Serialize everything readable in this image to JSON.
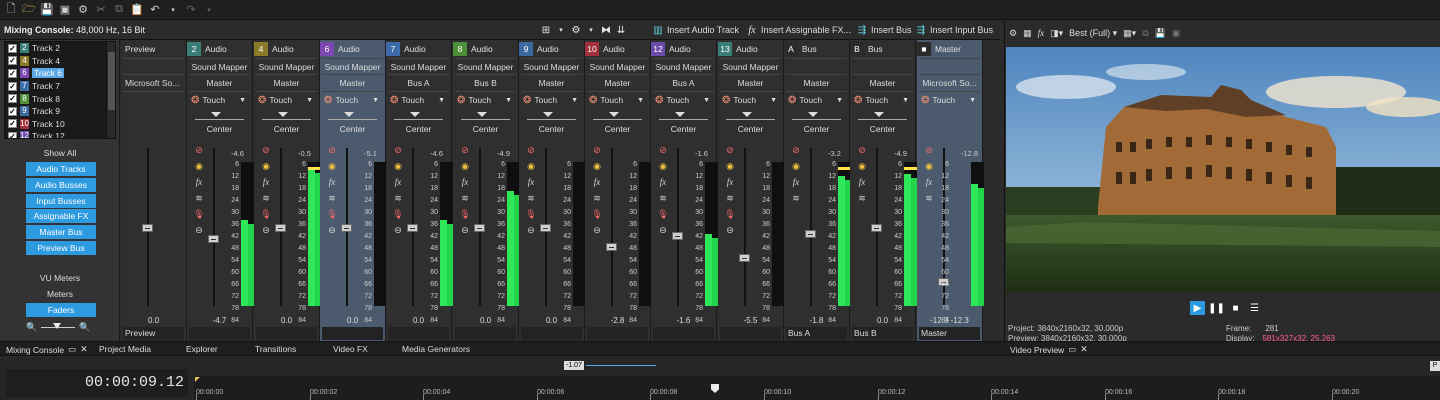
{
  "toolbar": {
    "icons": [
      "new-file-icon",
      "open-folder-icon",
      "save-icon",
      "save-as-icon",
      "properties-gear-icon",
      "cut-icon",
      "copy-icon",
      "paste-icon",
      "undo-icon",
      "undo-dropdown-icon",
      "redo-icon",
      "redo-dropdown-icon"
    ]
  },
  "mixer": {
    "title": "Mixing Console:",
    "subtitle": "48,000 Hz, 16 Bit",
    "actions": {
      "insert_audio_track": "Insert Audio Track",
      "insert_assignable_fx": "Insert Assignable FX...",
      "insert_bus": "Insert Bus",
      "insert_input_bus": "Insert Input Bus"
    },
    "track_list": [
      {
        "num": "2",
        "label": "Track 2",
        "color": "#3b7e78",
        "selected": false
      },
      {
        "num": "4",
        "label": "Track 4",
        "color": "#8a7a2a",
        "selected": false
      },
      {
        "num": "6",
        "label": "Track 6",
        "color": "#7a48b0",
        "selected": true
      },
      {
        "num": "7",
        "label": "Track 7",
        "color": "#3d6aa8",
        "selected": false
      },
      {
        "num": "8",
        "label": "Track 8",
        "color": "#4f8f3a",
        "selected": false
      },
      {
        "num": "9",
        "label": "Track 9",
        "color": "#3b6aa0",
        "selected": false
      },
      {
        "num": "10",
        "label": "Track 10",
        "color": "#a0303a",
        "selected": false
      },
      {
        "num": "12",
        "label": "Track 12",
        "color": "#6a4aa8",
        "selected": false
      }
    ],
    "show_all": "Show All",
    "view_buttons": [
      "Audio Tracks",
      "Audio Busses",
      "Input Busses",
      "Assignable FX",
      "Master Bus",
      "Preview Bus"
    ],
    "vu_meters": "VU Meters",
    "meters": "Meters",
    "faders": "Faders",
    "meter_scale": [
      "6",
      "12",
      "18",
      "24",
      "30",
      "36",
      "42",
      "48",
      "54",
      "60",
      "66",
      "72",
      "78",
      "84"
    ],
    "strips": [
      {
        "num": "",
        "name": "Preview",
        "input": "",
        "output": "Microsoft So...",
        "touch": false,
        "center": false,
        "peak": "",
        "gain": "0.0",
        "bottom": "Preview",
        "color": "#2b2b2b",
        "level": 0,
        "hasMeter": false,
        "fader": 0.48
      },
      {
        "num": "2",
        "name": "Audio",
        "input": "Sound Mapper",
        "output": "Master",
        "touch": true,
        "center": true,
        "peak": "-4.6",
        "gain": "-4.7",
        "bottom": "",
        "color": "#3b7e78",
        "level": 0.6,
        "hasMeter": true,
        "fader": 0.55
      },
      {
        "num": "4",
        "name": "Audio",
        "input": "Sound Mapper",
        "output": "Master",
        "touch": true,
        "center": true,
        "peak": "-0.5",
        "gain": "0.0",
        "bottom": "",
        "color": "#8a7a2a",
        "level": 0.95,
        "hasMeter": true,
        "fader": 0.48
      },
      {
        "num": "6",
        "name": "Audio",
        "input": "Sound Mapper",
        "output": "Master",
        "touch": true,
        "center": true,
        "peak": "-5.1",
        "gain": "0.0",
        "bottom": "",
        "color": "#7a48b0",
        "level": 0.0,
        "hasMeter": true,
        "fader": 0.48,
        "selected": true
      },
      {
        "num": "7",
        "name": "Audio",
        "input": "Sound Mapper",
        "output": "Bus A",
        "touch": true,
        "center": true,
        "peak": "-4.6",
        "gain": "0.0",
        "bottom": "",
        "color": "#3d6aa8",
        "level": 0.6,
        "hasMeter": true,
        "fader": 0.48
      },
      {
        "num": "8",
        "name": "Audio",
        "input": "Sound Mapper",
        "output": "Bus B",
        "touch": true,
        "center": true,
        "peak": "-4.9",
        "gain": "0.0",
        "bottom": "",
        "color": "#4f8f3a",
        "level": 0.8,
        "hasMeter": true,
        "fader": 0.48
      },
      {
        "num": "9",
        "name": "Audio",
        "input": "Sound Mapper",
        "output": "Master",
        "touch": true,
        "center": true,
        "peak": "",
        "gain": "0.0",
        "bottom": "",
        "color": "#3b6aa0",
        "level": 0.0,
        "hasMeter": true,
        "fader": 0.48
      },
      {
        "num": "10",
        "name": "Audio",
        "input": "Sound Mapper",
        "output": "Master",
        "touch": true,
        "center": true,
        "peak": "",
        "gain": "-2.8",
        "bottom": "",
        "color": "#a0303a",
        "level": 0.0,
        "hasMeter": true,
        "fader": 0.6
      },
      {
        "num": "12",
        "name": "Audio",
        "input": "Sound Mapper",
        "output": "Bus A",
        "touch": true,
        "center": true,
        "peak": "-1.6",
        "gain": "-1.6",
        "bottom": "",
        "color": "#6a4aa8",
        "level": 0.5,
        "hasMeter": true,
        "fader": 0.53
      },
      {
        "num": "13",
        "name": "Audio",
        "input": "Sound Mapper",
        "output": "Master",
        "touch": true,
        "center": true,
        "peak": "",
        "gain": "-5.5",
        "bottom": "",
        "color": "#3b7e78",
        "level": 0.0,
        "hasMeter": true,
        "fader": 0.67
      },
      {
        "num": "A",
        "name": "Bus",
        "input": "",
        "output": "Master",
        "touch": true,
        "center": true,
        "peak": "-3.2",
        "gain": "-1.8",
        "bottom": "Bus A",
        "color": "#2b2b2b",
        "level": 0.9,
        "hasMeter": true,
        "fader": 0.52
      },
      {
        "num": "B",
        "name": "Bus",
        "input": "",
        "output": "Master",
        "touch": true,
        "center": true,
        "peak": "-4.9",
        "gain": "0.0",
        "bottom": "Bus B",
        "color": "#2b2b2b",
        "level": 0.92,
        "hasMeter": true,
        "fader": 0.48
      },
      {
        "num": "■",
        "name": "Master",
        "input": "",
        "output": "Microsoft So...",
        "touch": true,
        "center": false,
        "peak": "-12.8",
        "gain": "-12.3  -12.3",
        "bottom": "Master",
        "color": "#2b2b2b",
        "level": 0.85,
        "hasMeter": true,
        "fader": 0.82,
        "selected": true
      }
    ]
  },
  "video": {
    "quality": "Best (Full)",
    "project_label": "Project:",
    "project_value": "3840x2160x32, 30.000p",
    "preview_label": "Preview:",
    "preview_value": "3840x2160x32, 30.000p",
    "frame_label": "Frame:",
    "frame_value": "281",
    "display_label": "Display:",
    "display_value": "581x327x32, 25.263"
  },
  "tabs": [
    "Mixing Console",
    "Project Media",
    "Explorer",
    "Transitions",
    "Video FX",
    "Media Generators",
    "Video Preview"
  ],
  "timeline": {
    "timecode": "00:00:09.12",
    "marker": "-1.07",
    "ticks": [
      "00:00:00",
      "00:00:02",
      "00:00:04",
      "00:00:06",
      "00:00:08",
      "00:00:10",
      "00:00:12",
      "00:00:14",
      "00:00:16",
      "00:00:18",
      "00:00:20",
      "00:00:22"
    ]
  }
}
